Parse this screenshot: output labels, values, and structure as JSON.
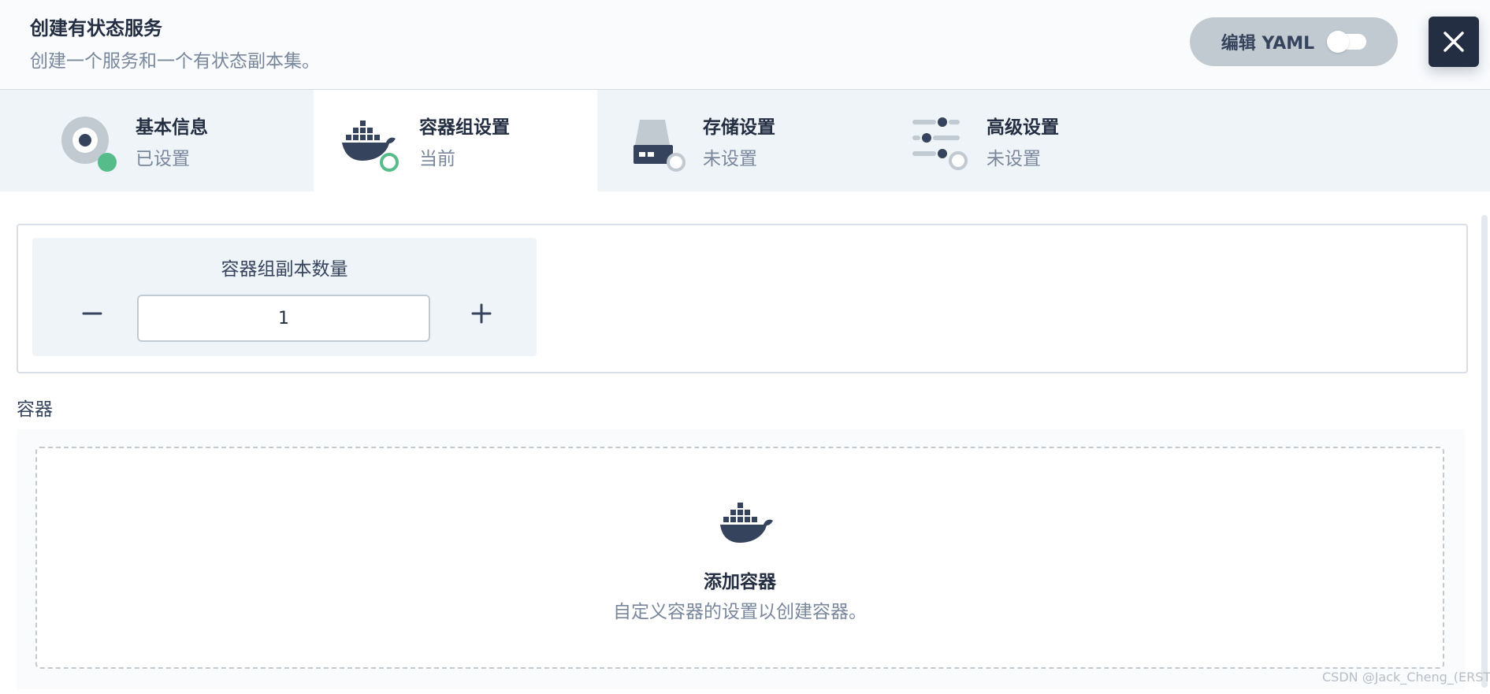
{
  "header": {
    "title": "创建有状态服务",
    "subtitle": "创建一个服务和一个有状态副本集。",
    "yaml_button_label": "编辑 YAML",
    "yaml_toggle_on": false
  },
  "steps": [
    {
      "title": "基本信息",
      "status": "已设置",
      "icon": "disc-icon",
      "state": "done"
    },
    {
      "title": "容器组设置",
      "status": "当前",
      "icon": "docker-icon",
      "state": "current"
    },
    {
      "title": "存储设置",
      "status": "未设置",
      "icon": "drive-icon",
      "state": "pending"
    },
    {
      "title": "高级设置",
      "status": "未设置",
      "icon": "sliders-icon",
      "state": "pending"
    }
  ],
  "replicas": {
    "label": "容器组副本数量",
    "value": "1"
  },
  "containers": {
    "section_label": "容器",
    "add_title": "添加容器",
    "add_description": "自定义容器的设置以创建容器。"
  },
  "watermark": "CSDN @Jack_Cheng_(ERSTATE)",
  "colors": {
    "primary_dark": "#242e42",
    "done_green": "#55bc8a",
    "muted_text": "#79879c",
    "step_bar_bg": "#eff4f9",
    "border": "#d8dee5"
  }
}
